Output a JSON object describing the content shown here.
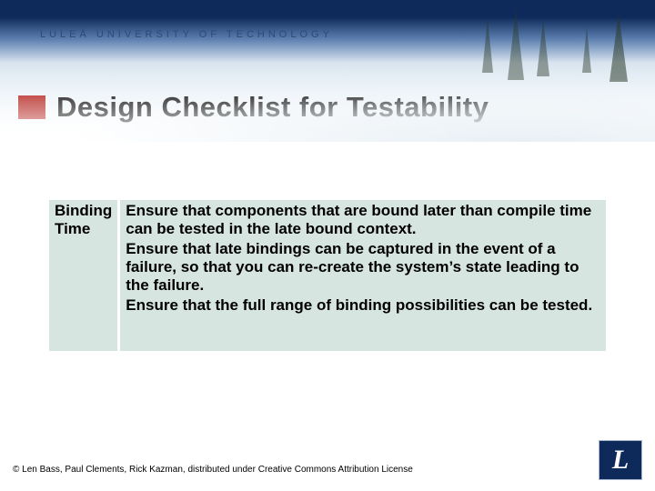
{
  "university": "LULEÅ  UNIVERSITY  OF  TECHNOLOGY",
  "title": "Design Checklist for Testability",
  "row": {
    "label": "Binding Time",
    "paras": [
      "Ensure that components that are bound later than compile time can be tested in the late bound context.",
      "Ensure that late bindings can be captured in the event of a failure, so that you can re-create the system’s state leading to the failure.",
      "Ensure that the full range of binding possibilities can be tested."
    ]
  },
  "footer": "© Len Bass, Paul Clements, Rick Kazman, distributed under Creative Commons Attribution License",
  "logo_letter": "L"
}
